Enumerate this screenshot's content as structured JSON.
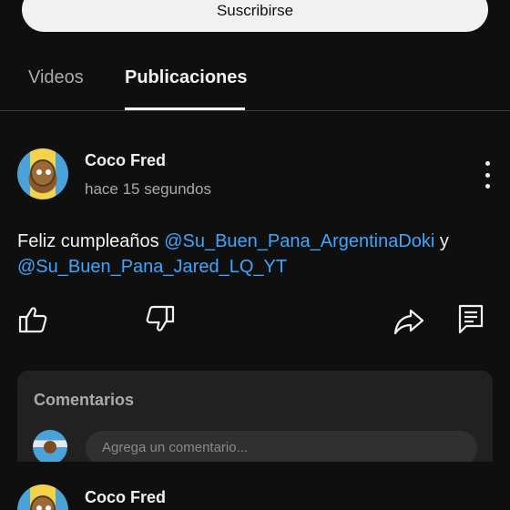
{
  "subscribe": {
    "label": "Suscribirse"
  },
  "tabs": [
    {
      "label": "Videos",
      "active": false
    },
    {
      "label": "Publicaciones",
      "active": true
    }
  ],
  "post": {
    "author": "Coco Fred",
    "timestamp": "hace 15 segundos",
    "text_prefix": "Feliz cumpleaños ",
    "mention1": "@Su_Buen_Pana_ArgentinaDoki",
    "text_mid": " y ",
    "mention2": "@Su_Buen_Pana_Jared_LQ_YT",
    "actions": [
      "like-icon",
      "dislike-icon",
      "share-icon",
      "comment-icon"
    ]
  },
  "comments": {
    "title": "Comentarios",
    "input_placeholder": "Agrega un comentario..."
  },
  "next_post": {
    "author": "Coco Fred"
  },
  "colors": {
    "background": "#0f0f0f",
    "card": "#212121",
    "mention": "#3ea6ff",
    "text": "#f1f1f1",
    "muted": "#aaaaaa"
  }
}
